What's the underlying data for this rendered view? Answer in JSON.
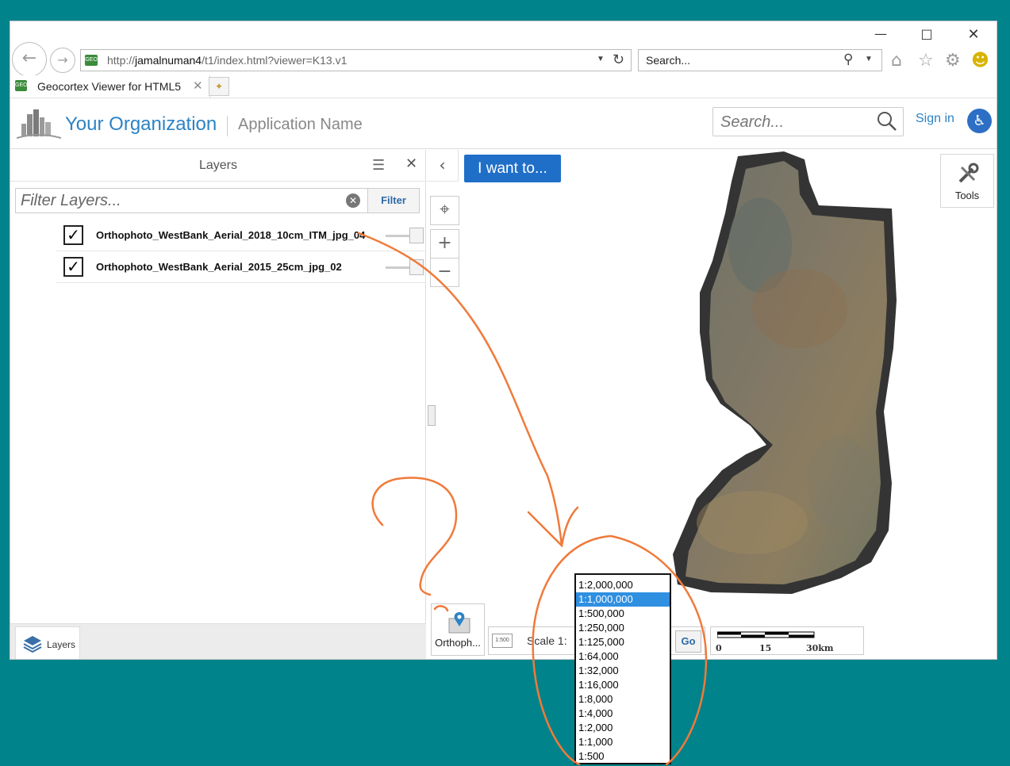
{
  "browser": {
    "url_prefix": "http://",
    "url_host": "jamalnuman4",
    "url_path": "/t1/index.html?viewer=K13.v1",
    "search_placeholder": "Search...",
    "tab_title": "Geocortex Viewer for HTML5",
    "favicon_text": "GEO"
  },
  "header": {
    "org_name": "Your Organization",
    "app_name": "Application Name",
    "search_placeholder": "Search...",
    "sign_in": "Sign in"
  },
  "layers_panel": {
    "title": "Layers",
    "filter_placeholder": "Filter Layers...",
    "filter_button": "Filter",
    "layers": [
      {
        "name": "Orthophoto_WestBank_Aerial_2018_10cm_ITM_jpg_04",
        "checked": true
      },
      {
        "name": "Orthophoto_WestBank_Aerial_2015_25cm_jpg_02",
        "checked": true
      }
    ],
    "bottom_tab": "Layers"
  },
  "map": {
    "i_want_to": "I want to...",
    "tools": "Tools",
    "ortho_button": "Orthoph...",
    "scale_icon_text": "1:500",
    "scale_label": "Scale 1:",
    "go_button": "Go",
    "scalebar_ticks": [
      "0",
      "15",
      "30km"
    ]
  },
  "scale_dropdown": {
    "options": [
      "1:2,000,000",
      "1:1,000,000",
      "1:500,000",
      "1:250,000",
      "1:125,000",
      "1:64,000",
      "1:32,000",
      "1:16,000",
      "1:8,000",
      "1:4,000",
      "1:2,000",
      "1:1,000",
      "1:500"
    ],
    "selected": "1:1,000,000"
  },
  "colors": {
    "desktop": "#00838a",
    "accent": "#1f6fc8",
    "annotation": "#f07a3a"
  }
}
